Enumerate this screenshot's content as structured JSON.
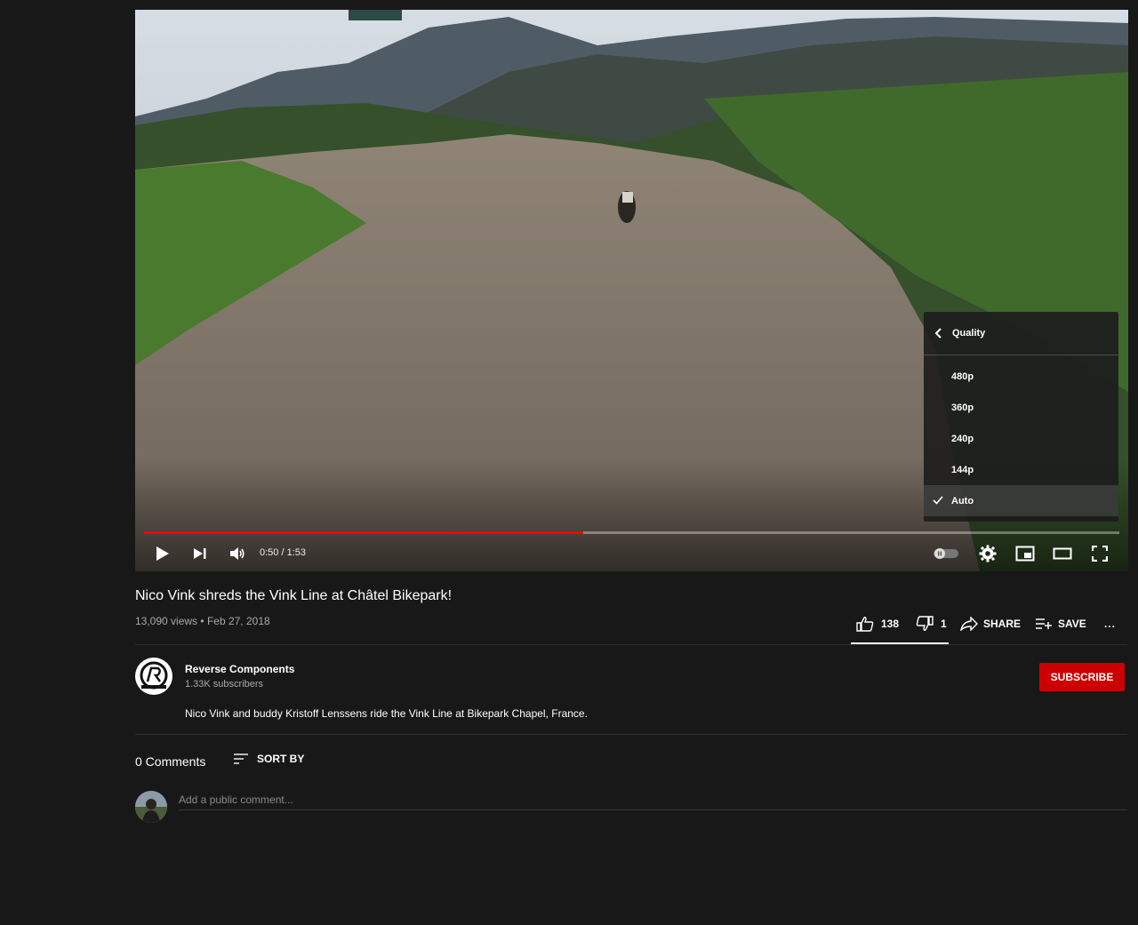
{
  "video": {
    "title": "Nico Vink shreds the Vink Line at Châtel Bikepark!",
    "views": "13,090 views",
    "separator": "•",
    "date": "Feb 27, 2018",
    "progress_fraction": 0.45
  },
  "player": {
    "time_current": "0:50",
    "time_separator": " / ",
    "time_total": "1:53",
    "controls": [
      "play-icon",
      "next-icon",
      "volume-icon",
      "autoplay-toggle",
      "settings-gear-icon",
      "miniplayer-icon",
      "theater-mode-icon",
      "fullscreen-icon"
    ],
    "quality_menu": {
      "header": "Quality",
      "options": [
        "480p",
        "360p",
        "240p",
        "144p",
        "Auto"
      ],
      "selected": "Auto"
    }
  },
  "actions": {
    "likes": "138",
    "dislikes": "1",
    "share_label": "SHARE",
    "save_label": "SAVE",
    "more": "..."
  },
  "channel": {
    "name": "Reverse Components",
    "subscribers": "1.33K subscribers",
    "subscribe_label": "SUBSCRIBE",
    "subscribe_color": "#cc0000"
  },
  "description": "Nico Vink and buddy Kristoff Lenssens ride the Vink Line at Bikepark Chapel, France.",
  "comments": {
    "count_label": "0 Comments",
    "sort_label": "SORT BY",
    "placeholder": "Add a public comment..."
  },
  "colors": {
    "background": "#181818",
    "progress": "#ff0000",
    "meta_text": "#aaaaaa"
  }
}
